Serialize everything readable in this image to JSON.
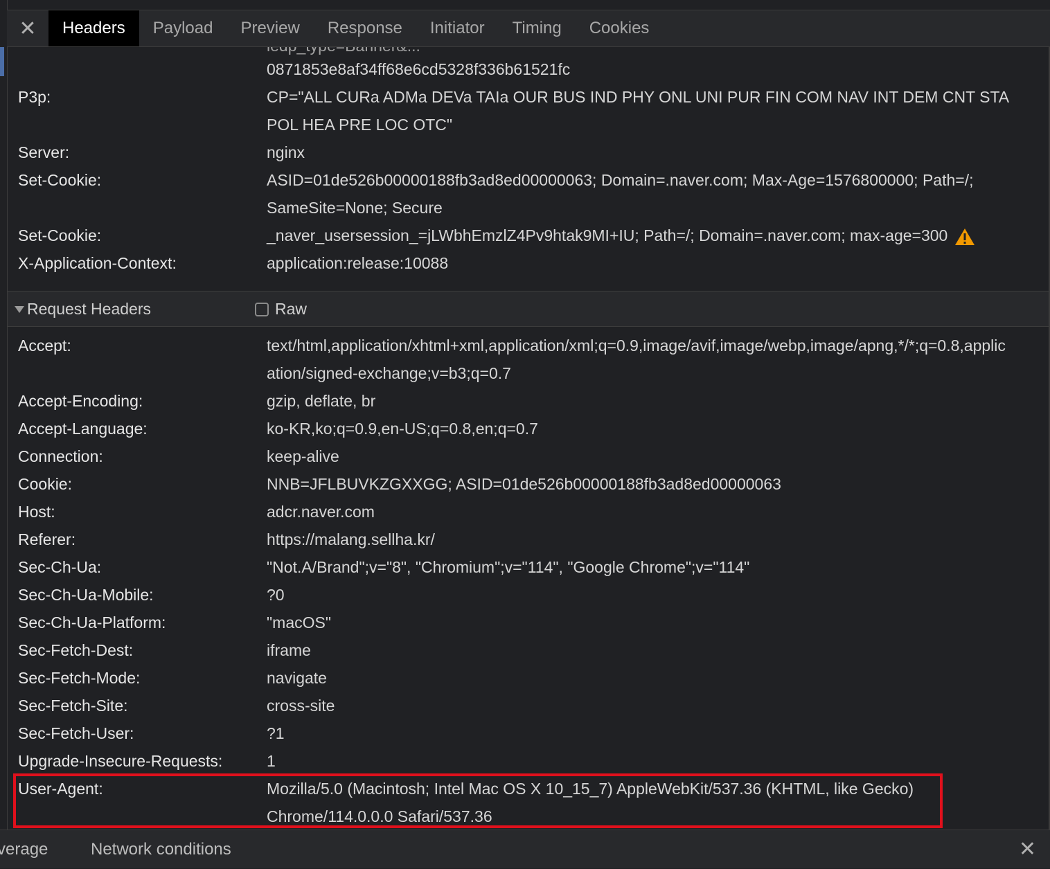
{
  "tabs": [
    "Headers",
    "Payload",
    "Preview",
    "Response",
    "Initiator",
    "Timing",
    "Cookies"
  ],
  "active_tab": "Headers",
  "response_headers": {
    "clipped_top": "ledp_type=Banner&...",
    "clipped_line": "0871853e8af34ff68e6cd5328f336b61521fc",
    "rows": [
      {
        "name": "P3p:",
        "value1": "CP=\"ALL CURa ADMa DEVa TAIa OUR BUS IND PHY ONL UNI PUR FIN COM NAV INT DEM CNT STA",
        "value2": "POL HEA PRE LOC OTC\""
      },
      {
        "name": "Server:",
        "value1": "nginx"
      },
      {
        "name": "Set-Cookie:",
        "value1": "ASID=01de526b00000188fb3ad8ed00000063; Domain=.naver.com; Max-Age=1576800000; Path=/;",
        "value2": "SameSite=None; Secure"
      },
      {
        "name": "Set-Cookie:",
        "value1": "_naver_usersession_=jLWbhEmzlZ4Pv9htak9MI+IU; Path=/; Domain=.naver.com; max-age=300",
        "warning": true
      },
      {
        "name": "X-Application-Context:",
        "value1": "application:release:10088"
      }
    ]
  },
  "request_section": {
    "title": "Request Headers",
    "raw_label": "Raw",
    "raw_checked": false
  },
  "request_headers": [
    {
      "name": "Accept:",
      "value1": "text/html,application/xhtml+xml,application/xml;q=0.9,image/avif,image/webp,image/apng,*/*;q=0.8,applic",
      "value2": "ation/signed-exchange;v=b3;q=0.7"
    },
    {
      "name": "Accept-Encoding:",
      "value1": "gzip, deflate, br"
    },
    {
      "name": "Accept-Language:",
      "value1": "ko-KR,ko;q=0.9,en-US;q=0.8,en;q=0.7"
    },
    {
      "name": "Connection:",
      "value1": "keep-alive"
    },
    {
      "name": "Cookie:",
      "value1": "NNB=JFLBUVKZGXXGG; ASID=01de526b00000188fb3ad8ed00000063"
    },
    {
      "name": "Host:",
      "value1": "adcr.naver.com"
    },
    {
      "name": "Referer:",
      "value1": "https://malang.sellha.kr/"
    },
    {
      "name": "Sec-Ch-Ua:",
      "value1": "\"Not.A/Brand\";v=\"8\", \"Chromium\";v=\"114\", \"Google Chrome\";v=\"114\""
    },
    {
      "name": "Sec-Ch-Ua-Mobile:",
      "value1": "?0"
    },
    {
      "name": "Sec-Ch-Ua-Platform:",
      "value1": "\"macOS\""
    },
    {
      "name": "Sec-Fetch-Dest:",
      "value1": "iframe"
    },
    {
      "name": "Sec-Fetch-Mode:",
      "value1": "navigate"
    },
    {
      "name": "Sec-Fetch-Site:",
      "value1": "cross-site"
    },
    {
      "name": "Sec-Fetch-User:",
      "value1": "?1"
    },
    {
      "name": "Upgrade-Insecure-Requests:",
      "value1": "1"
    },
    {
      "name": "User-Agent:",
      "value1": "Mozilla/5.0 (Macintosh; Intel Mac OS X 10_15_7) AppleWebKit/537.36 (KHTML, like Gecko)",
      "value2": "Chrome/114.0.0.0 Safari/537.36",
      "highlighted": true
    }
  ],
  "bottom_tabs": [
    "verage",
    "Network conditions"
  ],
  "colors": {
    "highlight": "#e0101c",
    "warning": "#f29900",
    "active_tab_bg": "#000000"
  }
}
